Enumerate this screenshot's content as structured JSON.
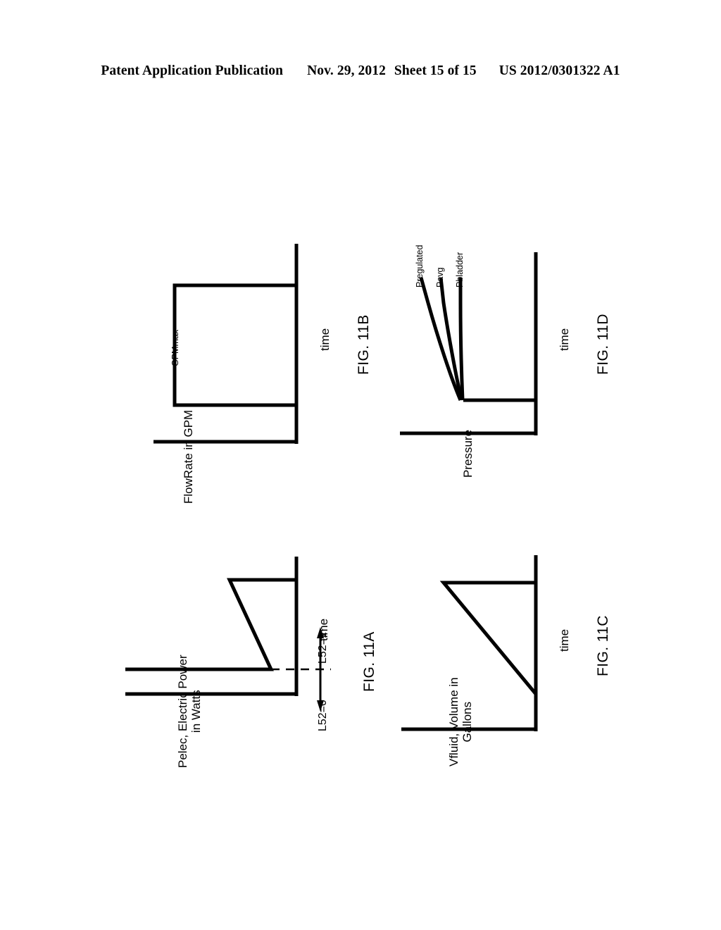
{
  "header": {
    "publication": "Patent Application Publication",
    "date": "Nov. 29, 2012",
    "sheet": "Sheet 15 of 15",
    "patent_number": "US 2012/0301322 A1"
  },
  "document": {
    "type": "patent-drawing-sheet",
    "orientation": "landscape-figures-on-portrait-page",
    "ink_color": "#000000",
    "background_color": "#ffffff"
  },
  "figures": [
    {
      "id": "fig-11a",
      "caption": "FIG. 11A",
      "x_axis_label": "time",
      "y_axis_label_line1": "Pelec, Electric Power",
      "y_axis_label_line2": "in Watts",
      "annotations": [
        {
          "name": "state-off",
          "text": "L52=0"
        },
        {
          "name": "state-on",
          "text": "L52=1"
        }
      ],
      "chart_data": {
        "type": "line",
        "title": "FIG. 11A",
        "xlabel": "time",
        "ylabel": "Pelec, Electric Power in Watts",
        "grid": false,
        "legend": "none",
        "xlim": [
          0,
          1
        ],
        "ylim": [
          0,
          1
        ],
        "series": [
          {
            "name": "Pelec",
            "x": [
              0.0,
              0.03,
              0.06,
              0.36,
              0.97,
              1.0
            ],
            "y": [
              0.0,
              0.86,
              0.86,
              0.33,
              0.33,
              0.33
            ],
            "description": "Step up to peak power at motor start, linear decay to steady-state running power, then constant"
          }
        ],
        "annotations": [
          {
            "text": "L52=0",
            "x": 0.015,
            "y": 0.33,
            "side": "left-of-threshold"
          },
          {
            "text": "L52=1",
            "x": 0.06,
            "y": 0.33,
            "side": "right-of-threshold"
          },
          {
            "text": "dashed threshold line at steady-state power",
            "y": 0.33
          }
        ]
      }
    },
    {
      "id": "fig-11b",
      "caption": "FIG. 11B",
      "x_axis_label": "time",
      "y_axis_label_line1": "FlowRate in GPM",
      "y_axis_label_line2": "",
      "annotations": [
        {
          "name": "flow-max",
          "text": "GPMmax"
        }
      ],
      "chart_data": {
        "type": "line",
        "title": "FIG. 11B",
        "xlabel": "time",
        "ylabel": "FlowRate in GPM",
        "grid": false,
        "legend": "none",
        "xlim": [
          0,
          1
        ],
        "ylim": [
          0,
          1
        ],
        "series": [
          {
            "name": "FlowRate",
            "x": [
              0.0,
              0.04,
              0.04,
              0.84,
              0.84,
              1.0
            ],
            "y": [
              0.0,
              0.0,
              0.8,
              0.8,
              0.0,
              0.0
            ],
            "description": "Zero flow, step up to GPMmax, constant plateau, step back down to zero"
          }
        ],
        "annotations": [
          {
            "text": "GPMmax",
            "y": 0.8,
            "position": "at plateau level"
          }
        ]
      }
    },
    {
      "id": "fig-11c",
      "caption": "FIG. 11C",
      "x_axis_label": "time",
      "y_axis_label_line1": "Vfluid, Volume in",
      "y_axis_label_line2": "Gallons",
      "annotations": [],
      "chart_data": {
        "type": "line",
        "title": "FIG. 11C",
        "xlabel": "time",
        "ylabel": "Vfluid, Volume in Gallons",
        "grid": false,
        "legend": "none",
        "xlim": [
          0,
          1
        ],
        "ylim": [
          0,
          1
        ],
        "series": [
          {
            "name": "Vfluid",
            "x": [
              0.0,
              0.05,
              0.84,
              1.0
            ],
            "y": [
              0.86,
              0.86,
              0.0,
              0.0
            ],
            "description": "Full tank volume held briefly, then linear drawdown to empty"
          }
        ],
        "annotations": []
      }
    },
    {
      "id": "fig-11d",
      "caption": "FIG. 11D",
      "x_axis_label": "time",
      "y_axis_label_line1": "Pressure",
      "y_axis_label_line2": "",
      "annotations": [],
      "chart_data": {
        "type": "line",
        "title": "FIG. 11D",
        "xlabel": "time",
        "ylabel": "Pressure",
        "grid": false,
        "legend": "inline-curve-labels",
        "xlim": [
          0,
          1
        ],
        "ylim": [
          0,
          1
        ],
        "series": [
          {
            "name": "Pregulated",
            "x": [
              0.0,
              0.08,
              0.18,
              0.3,
              0.45,
              0.62,
              0.78,
              1.0
            ],
            "y": [
              0.12,
              0.13,
              0.17,
              0.28,
              0.48,
              0.68,
              0.82,
              0.92
            ],
            "description": "Regulated pressure rising steeply then flattening at top — outermost curve"
          },
          {
            "name": "Pavg",
            "x": [
              0.0,
              0.08,
              0.2,
              0.36,
              0.55,
              0.75,
              1.0
            ],
            "y": [
              0.12,
              0.13,
              0.2,
              0.4,
              0.62,
              0.8,
              0.9
            ],
            "description": "Average pressure, middle curve"
          },
          {
            "name": "Pbladder",
            "x": [
              0.0,
              0.06,
              0.1,
              0.12,
              0.13,
              0.13,
              0.13
            ],
            "y": [
              0.12,
              0.13,
              0.3,
              0.55,
              0.75,
              0.88,
              0.92
            ],
            "description": "Bladder pressure, near-vertical innermost curve"
          }
        ],
        "annotations": [
          {
            "text": "Pregulated",
            "attached_to": "Pregulated"
          },
          {
            "text": "Pavg",
            "attached_to": "Pavg"
          },
          {
            "text": "Pbladder",
            "attached_to": "Pbladder"
          }
        ]
      }
    }
  ]
}
